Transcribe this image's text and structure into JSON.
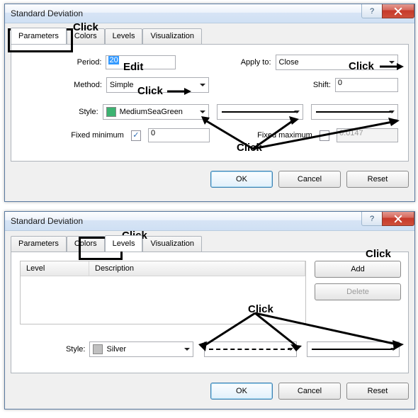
{
  "dialog1": {
    "title": "Standard Deviation",
    "tabs": {
      "parameters": "Parameters",
      "colors": "Colors",
      "levels": "Levels",
      "visualization": "Visualization"
    },
    "period_label": "Period:",
    "period_value": "20",
    "applyto_label": "Apply to:",
    "applyto_value": "Close",
    "method_label": "Method:",
    "method_value": "Simple",
    "shift_label": "Shift:",
    "shift_value": "0",
    "style_label": "Style:",
    "style_color_name": "MediumSeaGreen",
    "style_color_hex": "#3CB371",
    "fixed_min_label": "Fixed minimum",
    "fixed_min_checked": true,
    "fixed_min_value": "0",
    "fixed_max_label": "Fixed maximum",
    "fixed_max_checked": false,
    "fixed_max_value": "0.0147",
    "ok": "OK",
    "cancel": "Cancel",
    "reset": "Reset"
  },
  "dialog2": {
    "title": "Standard Deviation",
    "tabs": {
      "parameters": "Parameters",
      "colors": "Colors",
      "levels": "Levels",
      "visualization": "Visualization"
    },
    "table": {
      "level": "Level",
      "description": "Description"
    },
    "add": "Add",
    "delete": "Delete",
    "style_label": "Style:",
    "style_color_name": "Silver",
    "style_color_hex": "#C0C0C0",
    "ok": "OK",
    "cancel": "Cancel",
    "reset": "Reset"
  },
  "annotations": {
    "click": "Click",
    "edit": "Edit"
  }
}
